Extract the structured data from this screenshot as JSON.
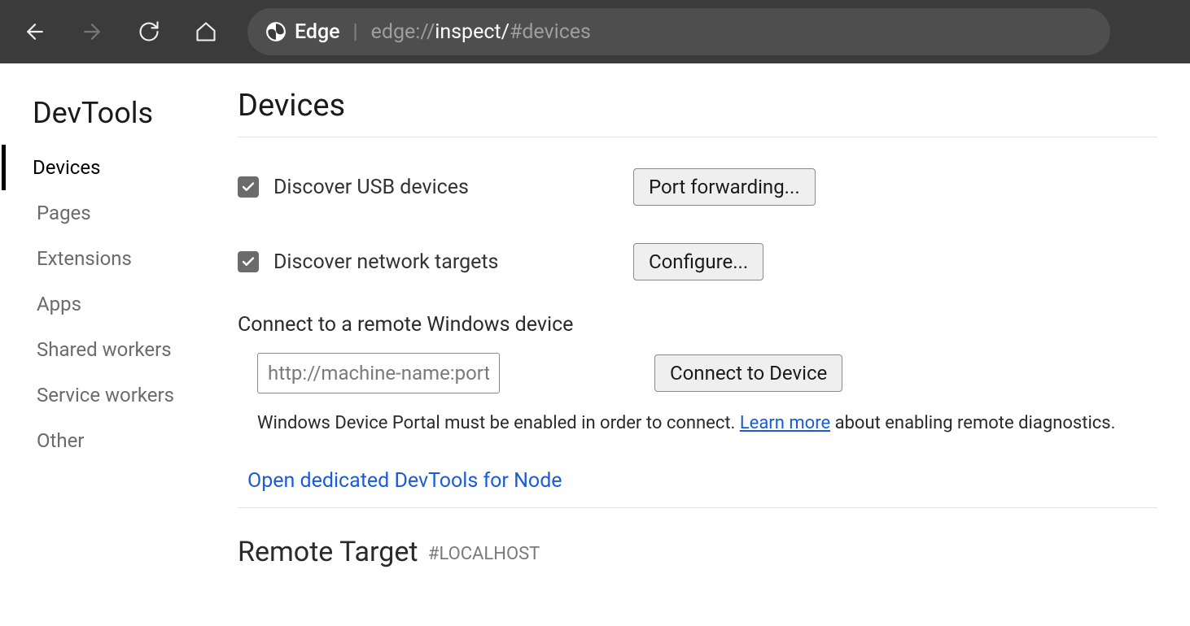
{
  "chrome": {
    "browser_label": "Edge",
    "url_dim_prefix": "edge://",
    "url_bright": "inspect/",
    "url_dim_suffix": "#devices"
  },
  "sidebar": {
    "title": "DevTools",
    "items": [
      {
        "label": "Devices",
        "active": true
      },
      {
        "label": "Pages",
        "active": false
      },
      {
        "label": "Extensions",
        "active": false
      },
      {
        "label": "Apps",
        "active": false
      },
      {
        "label": "Shared workers",
        "active": false
      },
      {
        "label": "Service workers",
        "active": false
      },
      {
        "label": "Other",
        "active": false
      }
    ]
  },
  "content": {
    "heading": "Devices",
    "discover_usb": {
      "checked": true,
      "label": "Discover USB devices",
      "button": "Port forwarding..."
    },
    "discover_network": {
      "checked": true,
      "label": "Discover network targets",
      "button": "Configure..."
    },
    "remote_windows": {
      "section_label": "Connect to a remote Windows device",
      "placeholder": "http://machine-name:port",
      "button": "Connect to Device",
      "helper_prefix": "Windows Device Portal must be enabled in order to connect. ",
      "helper_link": "Learn more",
      "helper_suffix": " about enabling remote diagnostics."
    },
    "node_link": "Open dedicated DevTools for Node",
    "remote_target": {
      "title": "Remote Target",
      "tag": "#LOCALHOST"
    }
  }
}
